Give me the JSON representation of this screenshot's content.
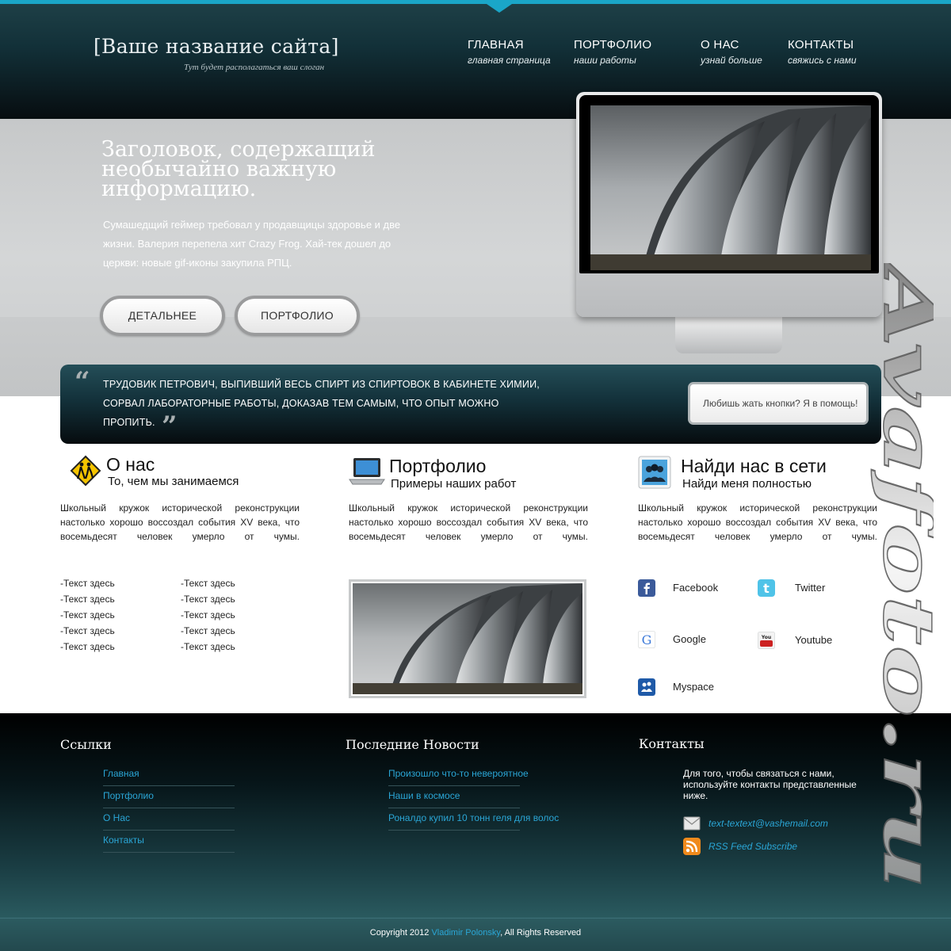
{
  "header": {
    "site_title": "[Ваше название сайта]",
    "slogan": "Тут будет располагаться ваш слоган",
    "nav": [
      {
        "label": "ГЛАВНАЯ",
        "sub": "главная страница"
      },
      {
        "label": "ПОРТФОЛИО",
        "sub": "наши работы"
      },
      {
        "label": "О НАС",
        "sub": "узнай больше"
      },
      {
        "label": "КОНТАКТЫ",
        "sub": "свяжись с нами"
      }
    ]
  },
  "hero": {
    "title": "Заголовок, содержащий необычайно важную информацию.",
    "text": "Сумашедщий геймер требовал у продавщицы здоровье и две жизни. Валерия перепела хит Crazy Frog. Хай-тек дошел до церкви: новые gif-иконы закупила РПЦ.",
    "btn_details": "ДЕТАЛЬНЕЕ",
    "btn_portfolio": "ПОРТФОЛИО",
    "apple_glyph": ""
  },
  "quote": {
    "open_mark": "“",
    "close_mark": "”",
    "text": "Трудовик Петрович, выпивший весь спирт из спиртовок в кабинете химии, сорвал лабораторные работы, доказав тем самым, что опыт можно пропить.",
    "button": "Любишь жать кнопки? Я в помощь!"
  },
  "columns": [
    {
      "title": "О нас",
      "subtitle": "То, чем мы занимаемся",
      "icon": "pedestrian-sign-icon",
      "text": "Школьный кружок исторической реконструкции настолько хорошо воссоздал события XV века, что восемьдесят человек умерло от чумы."
    },
    {
      "title": "Портфолио",
      "subtitle": "Примеры наших работ",
      "icon": "laptop-icon",
      "text": "Школьный кружок исторической реконструкции настолько хорошо воссоздал события XV века, что восемьдесят человек умерло от чумы."
    },
    {
      "title": "Найди нас в сети",
      "subtitle": "Найди меня полностью",
      "icon": "people-icon",
      "text": "Школьный кружок исторической реконструкции настолько хорошо воссоздал события XV века, что восемьдесят человек умерло от чумы."
    }
  ],
  "about_list_a": [
    "-Текст здесь",
    "-Текст здесь",
    "-Текст здесь",
    "-Текст здесь",
    "-Текст здесь"
  ],
  "about_list_b": [
    "-Текст здесь",
    "-Текст здесь",
    "-Текст здесь",
    "-Текст здесь",
    "-Текст здесь"
  ],
  "social": [
    {
      "label": "Facebook",
      "color": "#3b5a9a"
    },
    {
      "label": "Twitter",
      "color": "#4fc3e8"
    },
    {
      "label": "Google",
      "color": "#ffffff"
    },
    {
      "label": "Youtube",
      "color": "#cc2222"
    },
    {
      "label": "Myspace",
      "color": "#1f5aa8"
    }
  ],
  "footer": {
    "links_title": "Ссылки",
    "links": [
      "Главная",
      "Портфолио",
      "О Нас",
      "Контакты"
    ],
    "news_title": "Последние Новости",
    "news": [
      "Произошло что-то невероятное",
      "Наши в космосе",
      "Роналдо купил 10 тонн геля для волос"
    ],
    "contacts_title": "Контакты",
    "contacts_text": "Для того, чтобы связаться с нами, используйте контакты представленные ниже.",
    "email": "text-textext@vashemail.com",
    "rss": "RSS Feed Subscribe"
  },
  "copyright": {
    "prefix": "Copyright 2012 ",
    "author": "Vladimir Polonsky",
    "suffix": ", All Rights Reserved"
  },
  "watermark": "Avafoto.ru",
  "colors": {
    "accent": "#1aa6c8",
    "link": "#2aa6d6",
    "header_dark": "#070d10",
    "footer_teal": "#2a5a5f"
  }
}
